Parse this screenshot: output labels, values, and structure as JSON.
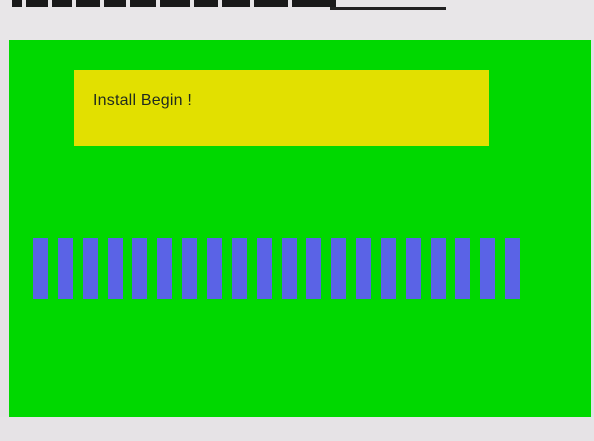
{
  "screen": {
    "background_color": "#00d800",
    "message": "Install Begin !",
    "message_box_color": "#e2e000"
  },
  "progress": {
    "segments_filled": 20,
    "segment_color": "#5a63e6"
  }
}
